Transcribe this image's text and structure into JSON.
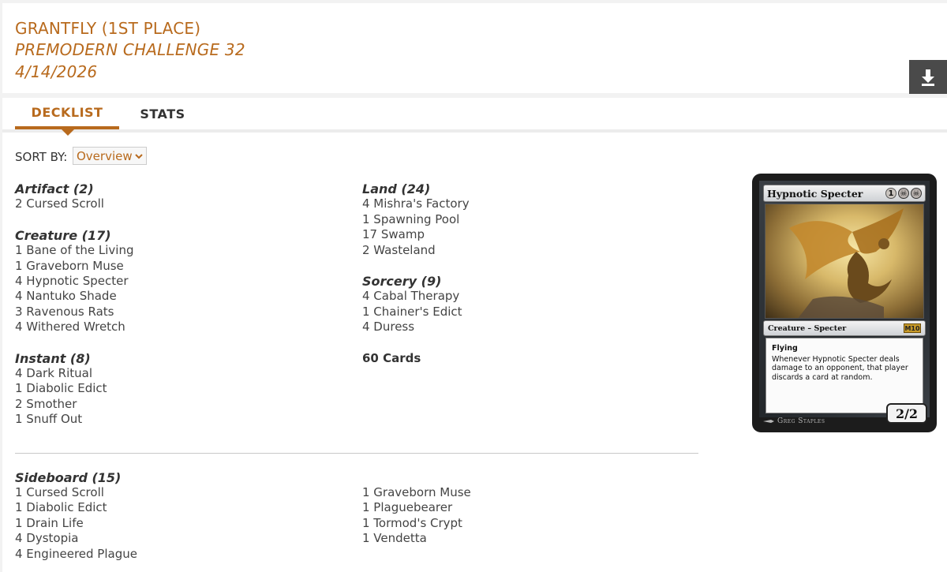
{
  "header": {
    "player": "GRANTFLY (1ST PLACE)",
    "event": "PREMODERN CHALLENGE 32",
    "date": "4/14/2026"
  },
  "tabs": [
    {
      "label": "DECKLIST",
      "active": true
    },
    {
      "label": "STATS",
      "active": false
    }
  ],
  "sort": {
    "label": "SORT BY:",
    "selected": "Overview"
  },
  "mainboard": {
    "left": [
      {
        "heading": "Artifact (2)",
        "cards": [
          "2 Cursed Scroll"
        ]
      },
      {
        "heading": "Creature (17)",
        "cards": [
          "1 Bane of the Living",
          "1 Graveborn Muse",
          "4 Hypnotic Specter",
          "4 Nantuko Shade",
          "3 Ravenous Rats",
          "4 Withered Wretch"
        ]
      },
      {
        "heading": "Instant (8)",
        "cards": [
          "4 Dark Ritual",
          "1 Diabolic Edict",
          "2 Smother",
          "1 Snuff Out"
        ]
      }
    ],
    "right": [
      {
        "heading": "Land (24)",
        "cards": [
          "4 Mishra's Factory",
          "1 Spawning Pool",
          "17 Swamp",
          "2 Wasteland"
        ]
      },
      {
        "heading": "Sorcery (9)",
        "cards": [
          "4 Cabal Therapy",
          "1 Chainer's Edict",
          "4 Duress"
        ]
      }
    ],
    "total": "60 Cards"
  },
  "sideboard": {
    "heading": "Sideboard (15)",
    "left": [
      "1 Cursed Scroll",
      "1 Diabolic Edict",
      "1 Drain Life",
      "4 Dystopia",
      "4 Engineered Plague"
    ],
    "right": [
      "1 Graveborn Muse",
      "1 Plaguebearer",
      "1 Tormod's Crypt",
      "1 Vendetta"
    ]
  },
  "card_preview": {
    "name": "Hypnotic Specter",
    "mana_generic": "1",
    "type_line": "Creature – Specter",
    "set_symbol": "M10",
    "keyword": "Flying",
    "ability": "Whenever Hypnotic Specter deals damage to an opponent, that player discards a card at random.",
    "power_toughness": "2/2",
    "artist": "Greg Staples"
  },
  "colors": {
    "accent": "#b86a1d",
    "download_bg": "#4a4a4a"
  },
  "icons": {
    "download": "download-icon",
    "select": "chevron-down-icon"
  }
}
